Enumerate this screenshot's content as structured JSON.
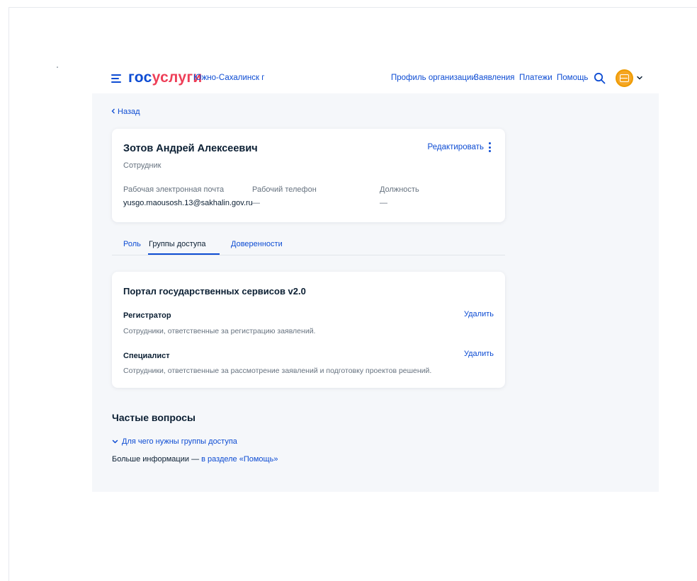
{
  "header": {
    "logo_part1": "гос",
    "logo_part2": "услуги",
    "city": "Южно-Сахалинск г",
    "nav": [
      "Профиль организации",
      "Заявления",
      "Платежи",
      "Помощь"
    ]
  },
  "back_label": "Назад",
  "employee": {
    "name": "Зотов Андрей Алексеевич",
    "role": "Сотрудник",
    "edit_label": "Редактировать",
    "email_label": "Рабочая электронная почта",
    "email_value": "yusgo.maousosh.13@sakhalin.gov.ru",
    "phone_label": "Рабочий телефон",
    "phone_value": "—",
    "position_label": "Должность",
    "position_value": "—"
  },
  "tabs": [
    {
      "label": "Роль",
      "active": false
    },
    {
      "label": "Группы доступа",
      "active": true
    },
    {
      "label": "Доверенности",
      "active": false
    }
  ],
  "access_groups": {
    "portal_title": "Портал государственных сервисов v2.0",
    "delete_label": "Удалить",
    "groups": [
      {
        "name": "Регистратор",
        "description": "Сотрудники, ответственные за регистрацию заявлений."
      },
      {
        "name": "Специалист",
        "description": "Сотрудники, ответственные за рассмотрение заявлений и подготовку проектов решений."
      }
    ]
  },
  "faq": {
    "title": "Частые вопросы",
    "question": "Для чего нужны группы доступа",
    "more_text": "Больше информации — ",
    "more_link": "в разделе «Помощь»"
  },
  "colors": {
    "accent": "#0d4cd3",
    "logo_red": "#ee3f58",
    "page_bg": "#f5f7fa",
    "text": "#0b1f33",
    "muted": "#66727f",
    "avatar": "#f5a623"
  },
  "icons": [
    "menu-icon",
    "search-icon",
    "avatar-icon",
    "chevron-down-icon",
    "kebab-icon",
    "chevron-left-icon"
  ]
}
